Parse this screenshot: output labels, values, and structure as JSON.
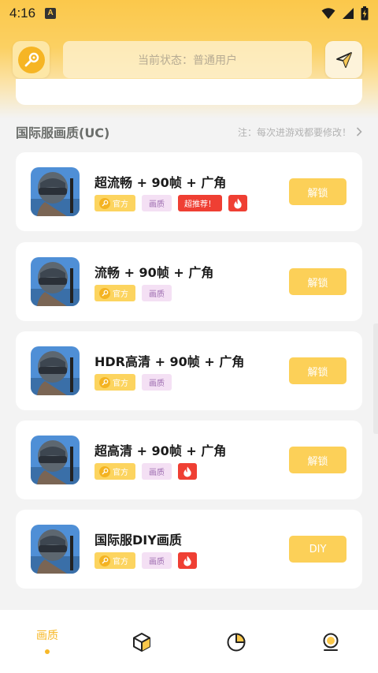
{
  "status_bar": {
    "time": "4:16",
    "a_icon": "A"
  },
  "header": {
    "status_text": "当前状态：普通用户"
  },
  "section": {
    "title": "国际服画质(UC)",
    "note": "注：每次进游戏都要修改！"
  },
  "tags": {
    "official": "官方",
    "quality": "画质",
    "recommend": "超推荐！"
  },
  "cards": [
    {
      "title": "超流畅 + 90帧 + 广角",
      "button": "解锁"
    },
    {
      "title": "流畅 + 90帧 + 广角",
      "button": "解锁"
    },
    {
      "title": "HDR高清 + 90帧 + 广角",
      "button": "解锁"
    },
    {
      "title": "超高清 + 90帧 + 广角",
      "button": "解锁"
    },
    {
      "title": "国际服DIY画质",
      "button": "DIY"
    }
  ],
  "nav": {
    "tab1": "画质"
  },
  "colors": {
    "accent": "#f7b829",
    "button": "#fcd058",
    "fire": "#ef3f33",
    "quality_tag": "#f4e0f4"
  }
}
